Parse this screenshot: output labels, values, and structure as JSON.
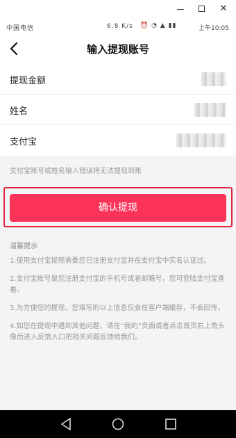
{
  "status_bar": {
    "carrier": "中国电信",
    "net_speed": "6.8 K/s",
    "icons": "⏰ ◔ ▲ ▮▮",
    "time": "上午10:05"
  },
  "header": {
    "title": "输入提现账号"
  },
  "form": {
    "rows": [
      {
        "label": "提现金额"
      },
      {
        "label": "姓名"
      },
      {
        "label": "支付宝"
      }
    ]
  },
  "hint": "支付宝账号或姓名输入错误将无法提现到账",
  "confirm_label": "确认提现",
  "tips": {
    "title": "温馨提示",
    "items": [
      "1.使用支付宝提现需要您已注册支付宝并在支付宝中实名认证过。",
      "2.支付宝帐号是您注册支付宝的手机号或者邮箱号，您可登陆支付宝查看。",
      "3.为方便您的提现，您填写的以上信息仅会在客户端缓存，不会回传。",
      "4.如您在提现中遇到其他问题，请在“我的”页面或者点击首页右上角头像后进入反馈入口把相关问题反馈给我们。"
    ]
  },
  "colors": {
    "accent": "#fb3359",
    "highlight_frame": "#e0253f"
  }
}
